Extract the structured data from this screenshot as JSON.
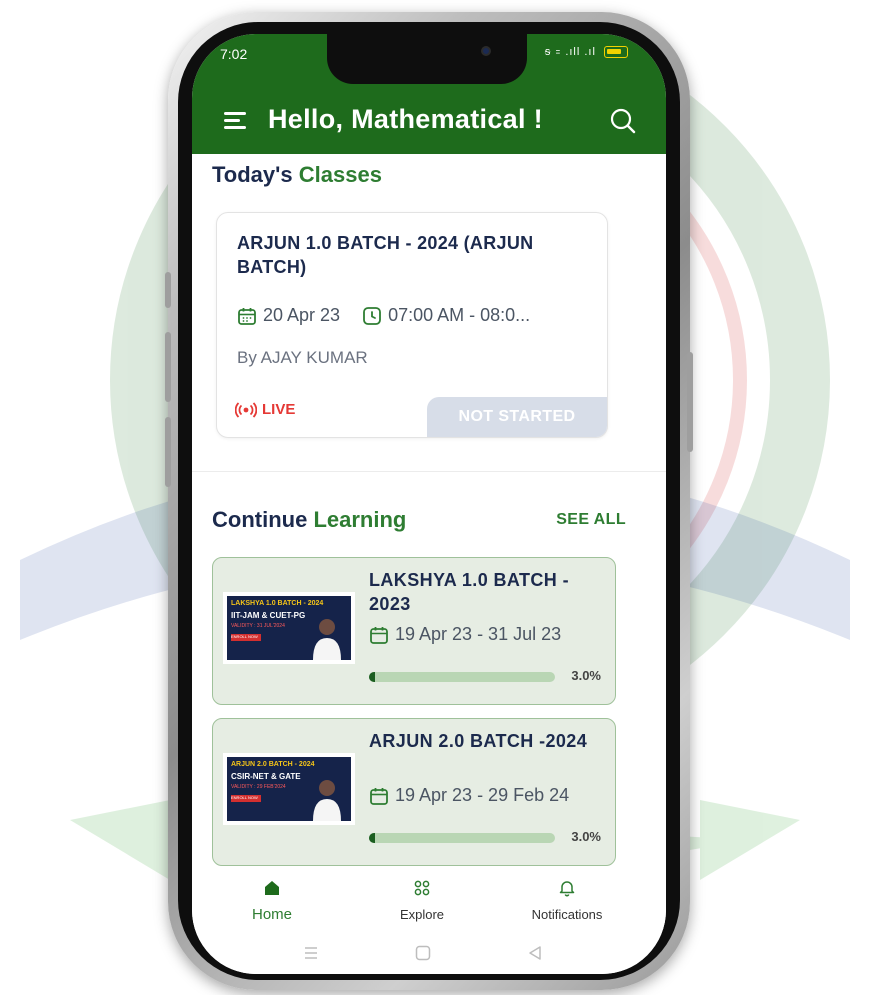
{
  "status_bar": {
    "time": "7:02",
    "signal_text": "ᵴ ꞊ .ıll .ıl"
  },
  "header": {
    "title": "Hello, Mathematical !"
  },
  "todays_classes": {
    "title_part1": "Today's",
    "title_part2": "Classes",
    "card": {
      "title": "ARJUN 1.0  BATCH - 2024 (ARJUN BATCH)",
      "date": "20 Apr 23",
      "time": "07:00 AM - 08:0...",
      "by": "By AJAY KUMAR",
      "live_label": "LIVE",
      "status_label": "NOT STARTED"
    }
  },
  "continue_learning": {
    "title_part1": "Continue",
    "title_part2": "Learning",
    "see_all": "SEE ALL",
    "courses": [
      {
        "title": "LAKSHYA 1.0  BATCH - 2023",
        "dates": "19 Apr 23 - 31 Jul 23",
        "progress": 0.03,
        "progress_label": "3.0%",
        "thumb_line1": "LAKSHYA 1.0 BATCH - 2024",
        "thumb_line2": "IIT-JAM & CUET-PG",
        "thumb_line3": "VALIDITY : 31 JUL'2024",
        "thumb_badge": "ENROLL NOW"
      },
      {
        "title": "ARJUN 2.0 BATCH -2024",
        "dates": "19 Apr 23 - 29 Feb 24",
        "progress": 0.03,
        "progress_label": "3.0%",
        "thumb_line1": "ARJUN 2.0 BATCH - 2024",
        "thumb_line2": "CSIR-NET & GATE",
        "thumb_line3": "VALIDITY : 29 FEB'2024",
        "thumb_badge": "ENROLL NOW"
      }
    ]
  },
  "bottom_nav": {
    "home": "Home",
    "explore": "Explore",
    "notifications": "Notifications"
  },
  "colors": {
    "brand_green": "#1e6b1c",
    "accent_green": "#2e7d32",
    "live_red": "#e53935",
    "title_navy": "#1c2a4d"
  }
}
